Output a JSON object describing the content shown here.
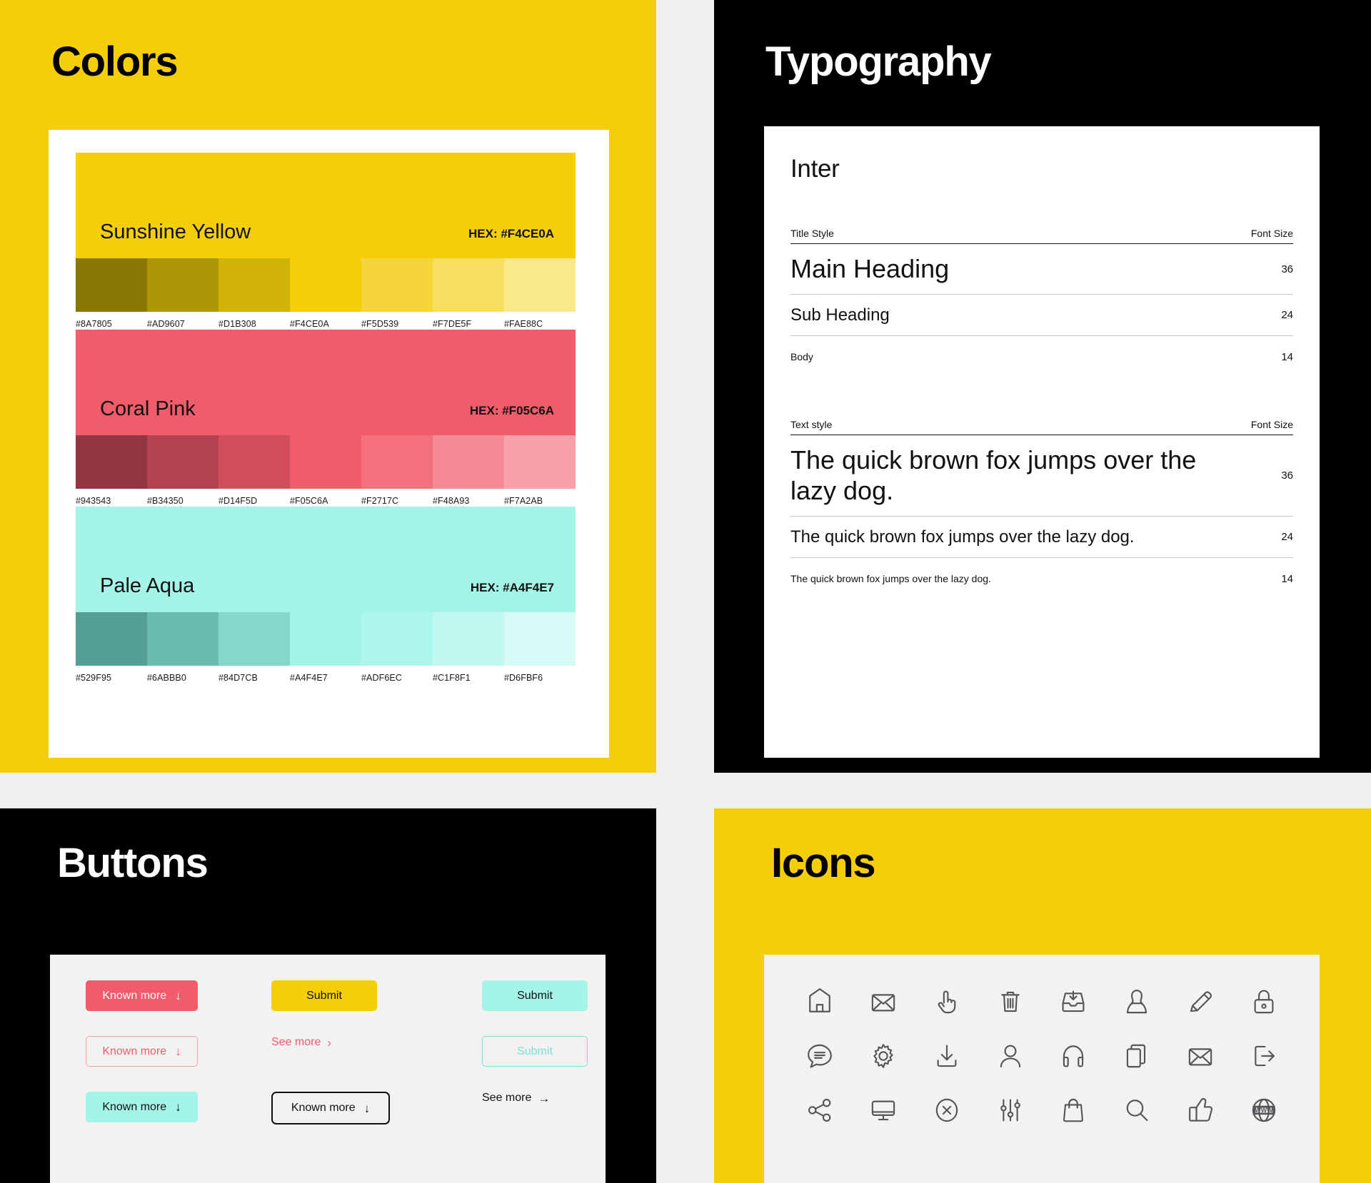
{
  "panels": {
    "colors": {
      "title": "Colors",
      "bg": "#F4CE0A"
    },
    "typography": {
      "title": "Typography",
      "bg": "#000000"
    },
    "buttons": {
      "title": "Buttons",
      "bg": "#000000"
    },
    "icons": {
      "title": "Icons",
      "bg": "#F4CE0A"
    }
  },
  "colors": {
    "palettes": [
      {
        "name": "Sunshine Yellow",
        "hex_label": "HEX: #F4CE0A",
        "base": "#F4CE0A",
        "shades": [
          "#8A7805",
          "#AD9607",
          "#D1B308",
          "#F4CE0A",
          "#F5D539",
          "#F7DE5F",
          "#FAE88C"
        ],
        "shade_labels": [
          "#8A7805",
          "#AD9607",
          "#D1B308",
          "#F4CE0A",
          "#F5D539",
          "#F7DE5F",
          "#FAE88C"
        ]
      },
      {
        "name": "Coral Pink",
        "hex_label": "HEX: #F05C6A",
        "base": "#F05C6A",
        "shades": [
          "#943543",
          "#B34350",
          "#D14F5D",
          "#F05C6A",
          "#F2717C",
          "#F48A93",
          "#F7A2AB"
        ],
        "shade_labels": [
          "#943543",
          "#B34350",
          "#D14F5D",
          "#F05C6A",
          "#F2717C",
          "#F48A93",
          "#F7A2AB"
        ]
      },
      {
        "name": "Pale Aqua",
        "hex_label": "HEX: #A4F4E7",
        "base": "#A4F4E7",
        "shades": [
          "#529F95",
          "#6ABBB0",
          "#84D7CB",
          "#A4F4E7",
          "#ADF6EC",
          "#C1F8F1",
          "#D6FBF6"
        ],
        "shade_labels": [
          "#529F95",
          "#6ABBB0",
          "#84D7CB",
          "#A4F4E7",
          "#ADF6EC",
          "#C1F8F1",
          "#D6FBF6"
        ]
      }
    ]
  },
  "typography": {
    "family": "Inter",
    "title_table": {
      "col_style": "Title Style",
      "col_size": "Font Size",
      "rows": [
        {
          "label": "Main Heading",
          "size": "36"
        },
        {
          "label": "Sub Heading",
          "size": "24"
        },
        {
          "label": "Body",
          "size": "14"
        }
      ]
    },
    "text_table": {
      "col_style": "Text style",
      "col_size": "Font Size",
      "rows": [
        {
          "label": "The quick brown fox jumps over the lazy dog.",
          "size": "36"
        },
        {
          "label": "The quick brown fox jumps over the lazy dog.",
          "size": "24"
        },
        {
          "label": "The quick brown fox jumps over the lazy dog.",
          "size": "14"
        }
      ]
    }
  },
  "buttons": {
    "items": [
      {
        "label": "Known more",
        "icon": "arrow-down-icon",
        "glyph": "↓",
        "variant": "pink-solid"
      },
      {
        "label": "Submit",
        "icon": "",
        "glyph": "",
        "variant": "yellow-solid"
      },
      {
        "label": "Submit",
        "icon": "",
        "glyph": "",
        "variant": "aqua-solid"
      },
      {
        "label": "Known more",
        "icon": "arrow-down-icon",
        "glyph": "↓",
        "variant": "pink-outline"
      },
      {
        "label": "See more",
        "icon": "chevron-right-icon",
        "glyph": "›",
        "variant": "pink-link"
      },
      {
        "label": "Submit",
        "icon": "",
        "glyph": "",
        "variant": "aqua-outline"
      },
      {
        "label": "Known more",
        "icon": "arrow-down-icon",
        "glyph": "↓",
        "variant": "aqua-solid"
      },
      {
        "label": "Known more",
        "icon": "arrow-down-icon",
        "glyph": "↓",
        "variant": "black-outline"
      },
      {
        "label": "See more",
        "icon": "arrow-right-icon",
        "glyph": "→",
        "variant": "black-link"
      }
    ]
  },
  "icons": {
    "items": [
      "home-icon",
      "envelope-icon",
      "pointing-hand-icon",
      "trash-icon",
      "inbox-download-icon",
      "user-female-icon",
      "pencil-icon",
      "lock-icon",
      "chat-bubble-icon",
      "gear-icon",
      "download-icon",
      "user-icon",
      "headphones-icon",
      "copy-icon",
      "mail-icon",
      "logout-icon",
      "share-icon",
      "monitor-icon",
      "close-circle-icon",
      "sliders-icon",
      "shopping-bag-icon",
      "search-icon",
      "thumbs-up-icon",
      "www-globe-icon"
    ]
  }
}
